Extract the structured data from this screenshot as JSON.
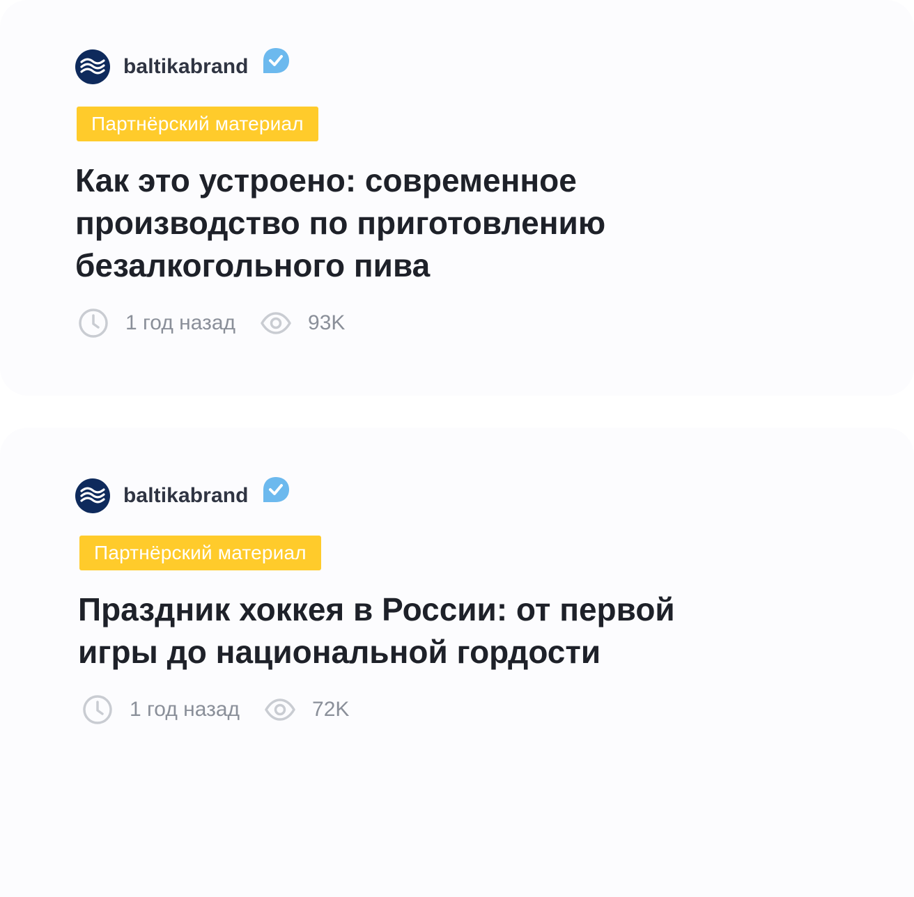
{
  "feed": {
    "posts": [
      {
        "author": "baltikabrand",
        "verified": true,
        "badge": "Партнёрский материал",
        "title": "Как это устроено: современное производство по приготовлению безалкогольного пива",
        "time": "1 год назад",
        "views": "93K"
      },
      {
        "author": "baltikabrand",
        "verified": true,
        "badge": "Партнёрский материал",
        "title": "Праздник хоккея в России: от первой игры до национальной гордости",
        "time": "1 год назад",
        "views": "72K"
      }
    ]
  },
  "colors": {
    "badge": "#ffcb2b",
    "verified": "#6cb9ee",
    "avatar": "#0e2a5c",
    "title": "#1e2129",
    "meta": "#8a8f99",
    "card": "#fcfcfe"
  },
  "icons": [
    "wave-logo-icon",
    "verified-check-icon",
    "clock-icon",
    "eye-icon"
  ]
}
